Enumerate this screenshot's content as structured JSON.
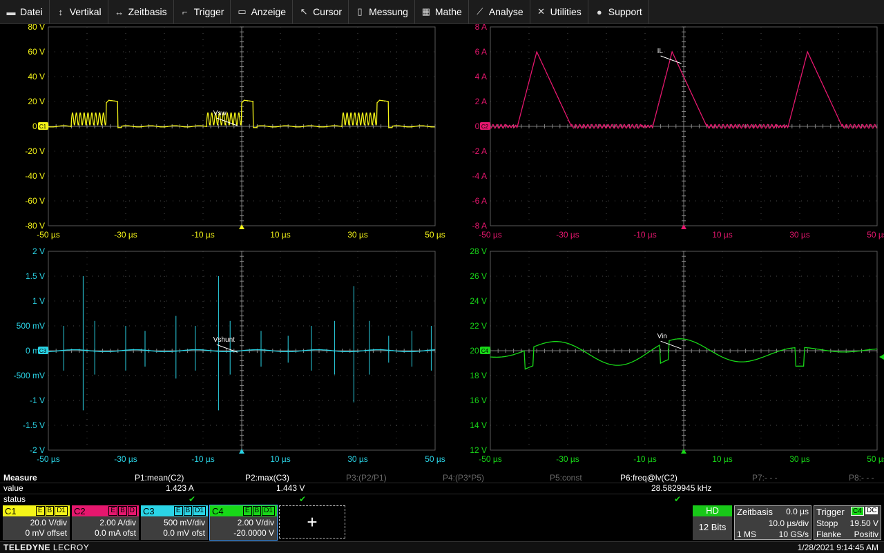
{
  "menu": [
    {
      "label": "Datei",
      "icon": "folder-icon",
      "glyph": "▬"
    },
    {
      "label": "Vertikal",
      "icon": "vertical-arrows-icon",
      "glyph": "↕"
    },
    {
      "label": "Zeitbasis",
      "icon": "horizontal-arrows-icon",
      "glyph": "↔"
    },
    {
      "label": "Trigger",
      "icon": "trigger-icon",
      "glyph": "⌐"
    },
    {
      "label": "Anzeige",
      "icon": "display-icon",
      "glyph": "▭"
    },
    {
      "label": "Cursor",
      "icon": "cursor-icon",
      "glyph": "↖"
    },
    {
      "label": "Messung",
      "icon": "ruler-icon",
      "glyph": "▯"
    },
    {
      "label": "Mathe",
      "icon": "calculator-icon",
      "glyph": "▦"
    },
    {
      "label": "Analyse",
      "icon": "analysis-icon",
      "glyph": "⟋"
    },
    {
      "label": "Utilities",
      "icon": "tools-icon",
      "glyph": "✕"
    },
    {
      "label": "Support",
      "icon": "info-icon",
      "glyph": "●"
    }
  ],
  "colors": {
    "c1": "#f5f518",
    "c2": "#e6176e",
    "c3": "#2ad4e6",
    "c4": "#18d818",
    "grid": "#4c4c4c",
    "bg": "#000000"
  },
  "panels": [
    {
      "channel": "C1",
      "color": "#f5f518",
      "label": "Vsw",
      "y_ticks": [
        "80 V",
        "60 V",
        "40 V",
        "20 V",
        "0 V",
        "-20 V",
        "-40 V",
        "-60 V",
        "-80 V"
      ],
      "x_ticks": [
        "-50 µs",
        "-30 µs",
        "-10 µs",
        "10 µs",
        "30 µs",
        "50 µs"
      ],
      "ylim": [
        -80,
        80
      ]
    },
    {
      "channel": "C2",
      "color": "#e6176e",
      "label": "IL",
      "y_ticks": [
        "8 A",
        "6 A",
        "4 A",
        "2 A",
        "0 A",
        "-2 A",
        "-4 A",
        "-6 A",
        "-8 A"
      ],
      "x_ticks": [
        "-50 µs",
        "-30 µs",
        "-10 µs",
        "10 µs",
        "30 µs",
        "50 µs"
      ],
      "ylim": [
        -8,
        8
      ]
    },
    {
      "channel": "C3",
      "color": "#2ad4e6",
      "label": "Vshunt",
      "y_ticks": [
        "2 V",
        "1.5 V",
        "1 V",
        "500 mV",
        "0 mV",
        "-500 mV",
        "-1 V",
        "-1.5 V",
        "-2 V"
      ],
      "x_ticks": [
        "-50 µs",
        "-30 µs",
        "-10 µs",
        "10 µs",
        "30 µs",
        "50 µs"
      ],
      "ylim": [
        -2,
        2
      ]
    },
    {
      "channel": "C4",
      "color": "#18d818",
      "label": "Vin",
      "y_ticks": [
        "28 V",
        "26 V",
        "24 V",
        "22 V",
        "20 V",
        "18 V",
        "16 V",
        "14 V",
        "12 V"
      ],
      "x_ticks": [
        "-50 µs",
        "-30 µs",
        "-10 µs",
        "10 µs",
        "30 µs",
        "50 µs"
      ],
      "ylim": [
        12,
        28
      ]
    }
  ],
  "measure": {
    "title": "Measure",
    "row_value": "value",
    "row_status": "status",
    "params": [
      {
        "name": "P1:mean(C2)",
        "value": "1.423 A",
        "ok": true,
        "active": true
      },
      {
        "name": "P2:max(C3)",
        "value": "1.443 V",
        "ok": true,
        "active": true
      },
      {
        "name": "P3:(P2/P1)",
        "value": "",
        "ok": false,
        "active": false
      },
      {
        "name": "P4:(P3*P5)",
        "value": "",
        "ok": false,
        "active": false
      },
      {
        "name": "P5:const",
        "value": "",
        "ok": false,
        "active": false
      },
      {
        "name": "P6:freq@lv(C2)",
        "value": "28.5829945 kHz",
        "ok": true,
        "active": true
      },
      {
        "name": "P7:- - -",
        "value": "",
        "ok": false,
        "active": false
      },
      {
        "name": "P8:- - -",
        "value": "",
        "ok": false,
        "active": false
      }
    ],
    "check_glyph": "✔"
  },
  "channels": [
    {
      "name": "C1",
      "color": "#f5f518",
      "tags": [
        "E",
        "B",
        "D1"
      ],
      "vdiv": "20.0 V/div",
      "offset": "0 mV offset"
    },
    {
      "name": "C2",
      "color": "#e6176e",
      "tags": [
        "E",
        "B",
        "D"
      ],
      "vdiv": "2.00 A/div",
      "offset": "0.0 mA ofst"
    },
    {
      "name": "C3",
      "color": "#2ad4e6",
      "tags": [
        "E",
        "B",
        "D1"
      ],
      "vdiv": "500 mV/div",
      "offset": "0.0 mV ofst"
    },
    {
      "name": "C4",
      "color": "#18d818",
      "tags": [
        "E",
        "B",
        "D1"
      ],
      "vdiv": "2.00 V/div",
      "offset": "-20.0000 V"
    }
  ],
  "add_glyph": "+",
  "acq": {
    "hd": "HD",
    "bits": "12 Bits"
  },
  "timebase": {
    "title": "Zeitbasis",
    "delay": "0.0 µs",
    "tdiv": "10.0 µs/div",
    "points": "1 MS",
    "rate": "10 GS/s"
  },
  "trigger": {
    "title": "Trigger",
    "source": "C4",
    "coupling": "DC",
    "mode": "Stopp",
    "level": "19.50 V",
    "type": "Flanke",
    "slope": "Positiv"
  },
  "footer": {
    "brand": "TELEDYNE",
    "brand2": "LECROY",
    "datetime": "1/28/2021 9:14:45 AM"
  }
}
